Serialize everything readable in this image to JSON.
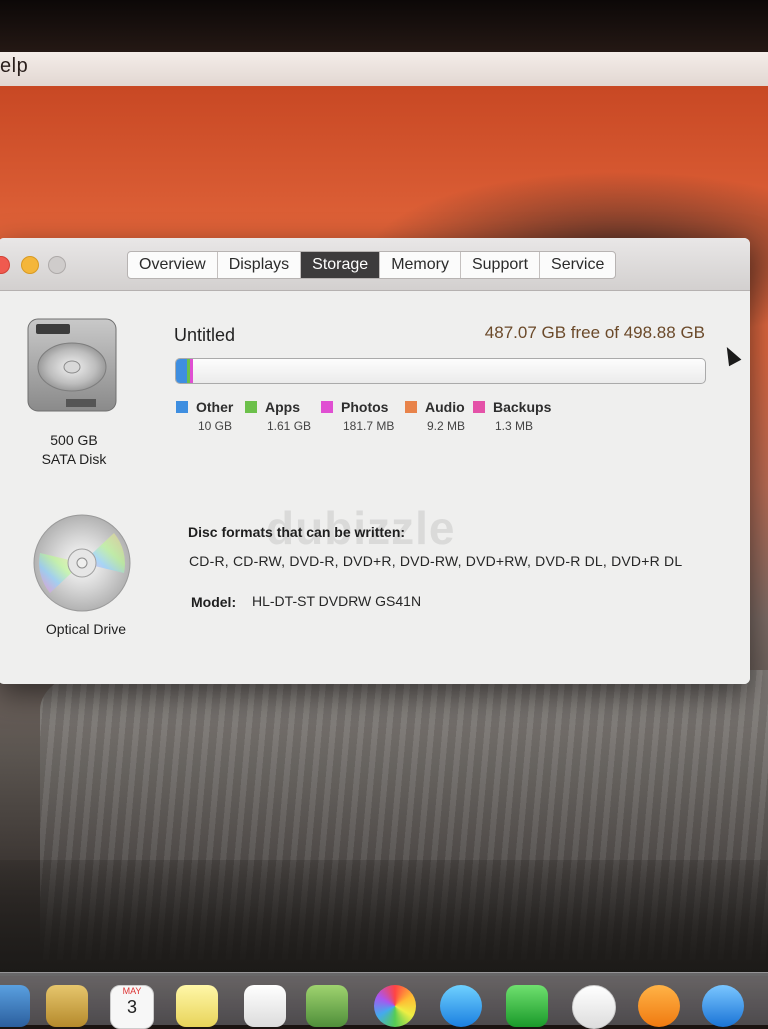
{
  "menubar": {
    "partial_menu": "elp"
  },
  "window": {
    "tabs": [
      {
        "label": "Overview",
        "active": false
      },
      {
        "label": "Displays",
        "active": false
      },
      {
        "label": "Storage",
        "active": true
      },
      {
        "label": "Memory",
        "active": false
      },
      {
        "label": "Support",
        "active": false
      },
      {
        "label": "Service",
        "active": false
      }
    ],
    "disk": {
      "size": "500 GB",
      "type": "SATA Disk",
      "icon": "hard-drive-icon"
    },
    "volume": {
      "name": "Untitled",
      "capacity_text": "487.07 GB free of 498.88 GB",
      "free_gb": 487.07,
      "total_gb": 498.88
    },
    "legend": [
      {
        "name": "Other",
        "size": "10 GB",
        "color": "#3e8ee0"
      },
      {
        "name": "Apps",
        "size": "1.61 GB",
        "color": "#6cc04a"
      },
      {
        "name": "Photos",
        "size": "181.7 MB",
        "color": "#e04fd2"
      },
      {
        "name": "Audio",
        "size": "9.2 MB",
        "color": "#e8834a"
      },
      {
        "name": "Backups",
        "size": "1.3 MB",
        "color": "#e452a8"
      }
    ],
    "optical": {
      "label": "Optical Drive",
      "icon": "optical-disc-icon",
      "formats_title": "Disc formats that can be written:",
      "formats": "CD-R, CD-RW, DVD-R, DVD+R, DVD-RW, DVD+RW, DVD-R DL, DVD+R DL",
      "model_label": "Model:",
      "model_value": "HL-DT-ST DVDRW GS41N"
    },
    "watermark": "dubizzle"
  },
  "dock": {
    "calendar_month": "MAY",
    "calendar_day": "3"
  },
  "colors": {
    "active_tab": "#3d3b3c",
    "capacity_text": "#6b4a2a"
  }
}
